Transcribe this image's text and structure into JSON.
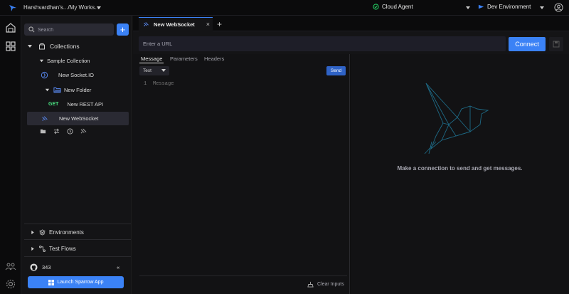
{
  "topbar": {
    "workspace_name": "Harshvardhan's.../My Works...",
    "agent_label": "Cloud Agent",
    "environment_label": "Dev Environment"
  },
  "sidebar": {
    "search_placeholder": "Search",
    "add_label": "+",
    "collections_label": "Collections",
    "tree": {
      "collection_name": "Sample Collection",
      "socketio_name": "New Socket.IO",
      "folder_name": "New Folder",
      "rest_method": "GET",
      "rest_name": "New REST API",
      "websocket_name": "New WebSocket"
    },
    "environments_label": "Environments",
    "testflows_label": "Test Flows",
    "github_stars": "343",
    "collapse_label": "«",
    "launch_label": "Launch Sparrow App"
  },
  "tabs": {
    "active_tab": "New WebSocket",
    "close_label": "×",
    "add_label": "+"
  },
  "request": {
    "url_placeholder": "Enter a URL",
    "connect_label": "Connect",
    "subtabs": [
      "Message",
      "Parameters",
      "Headers"
    ],
    "format_value": "Text",
    "send_label": "Send",
    "line_number": "1",
    "message_placeholder": "Message",
    "clear_label": "Clear Inputs"
  },
  "response": {
    "empty_message": "Make a connection to send and get messages."
  },
  "colors": {
    "accent": "#3b82f6",
    "agent_ok": "#22c55e",
    "get_method": "#4ade80"
  }
}
